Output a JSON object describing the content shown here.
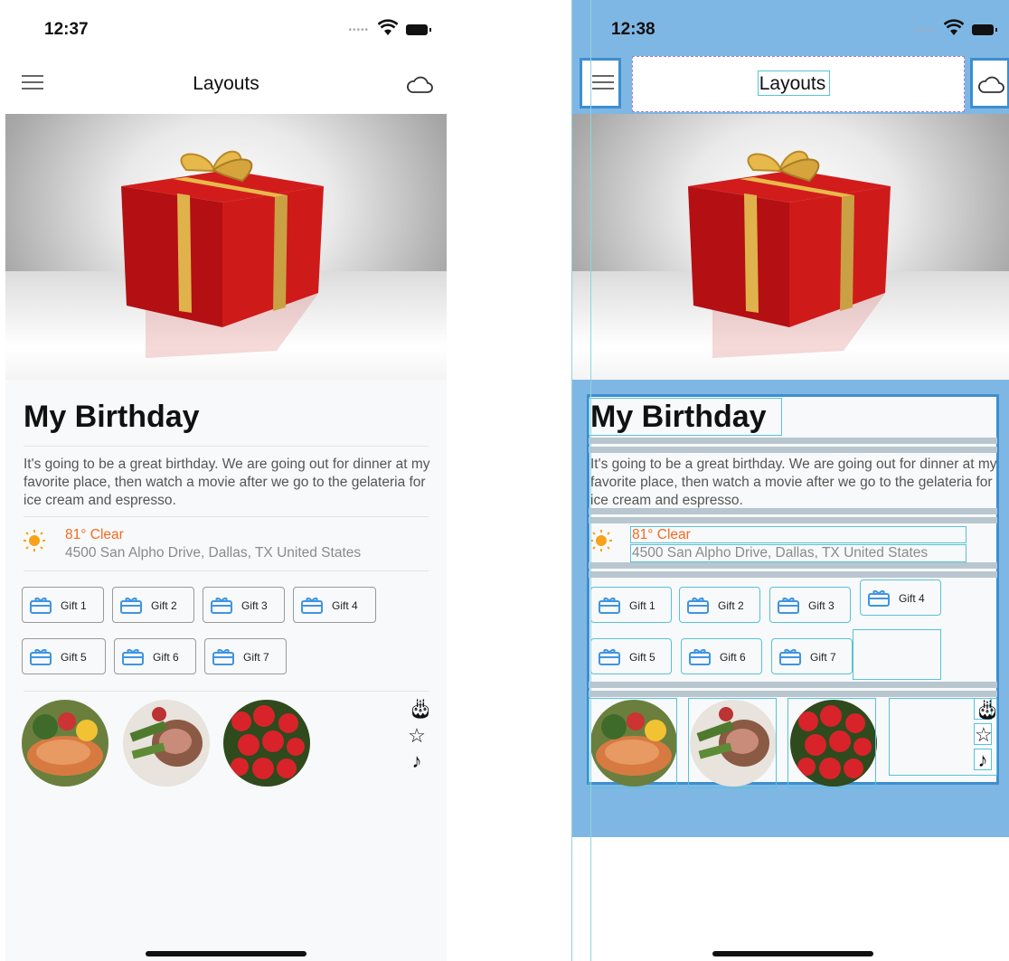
{
  "status_left": {
    "time": "12:37"
  },
  "status_right": {
    "time": "12:38"
  },
  "nav": {
    "title": "Layouts"
  },
  "event": {
    "title": "My Birthday",
    "description": "It's going to be a great birthday. We are going out for dinner at my favorite place, then watch a movie after we go to the gelateria for ice cream and espresso.",
    "weather": "81° Clear",
    "address": "4500 San Alpho Drive, Dallas, TX United States"
  },
  "gifts": [
    "Gift 1",
    "Gift 2",
    "Gift 3",
    "Gift 4",
    "Gift 5",
    "Gift 6",
    "Gift 7"
  ],
  "colors": {
    "accent_orange": "#f36b21",
    "gift_icon_blue": "#3f95e0",
    "debug_blue": "#7fb7e4"
  },
  "side_icons": [
    "cake-icon",
    "star-icon",
    "music-note-icon"
  ]
}
